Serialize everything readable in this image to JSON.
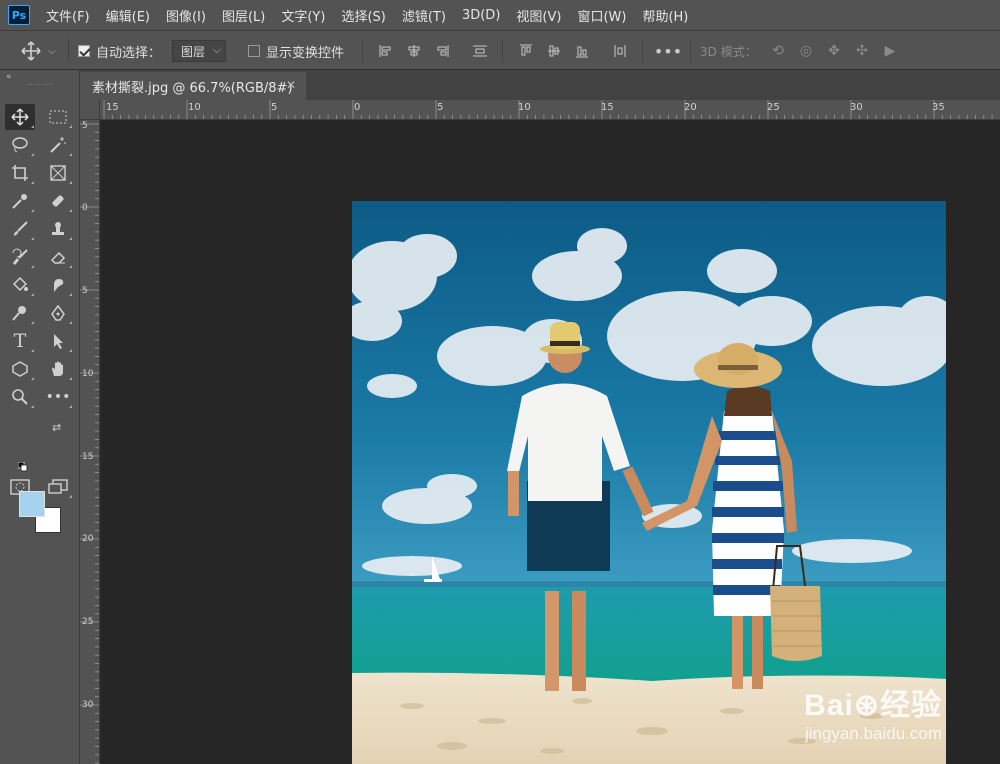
{
  "app": {
    "logo_text": "Ps"
  },
  "menu": {
    "items": [
      "文件(F)",
      "编辑(E)",
      "图像(I)",
      "图层(L)",
      "文字(Y)",
      "选择(S)",
      "滤镜(T)",
      "3D(D)",
      "视图(V)",
      "窗口(W)",
      "帮助(H)"
    ]
  },
  "options": {
    "auto_select_label": "自动选择：",
    "auto_select_value": "图层",
    "show_transform_label": "显示变换控件",
    "mode3d_label": "3D 模式："
  },
  "document": {
    "tab_title": "素材撕裂.jpg @ 66.7%(RGB/8#)",
    "close_glyph": "✕"
  },
  "ruler": {
    "top_labels": [
      "15",
      "10",
      "5",
      "0",
      "5",
      "10",
      "15",
      "20",
      "25",
      "30",
      "35"
    ],
    "left_labels": [
      "5",
      "0",
      "5",
      "10",
      "15",
      "20",
      "25",
      "30"
    ]
  },
  "colors": {
    "foreground": "#a7d2ee",
    "background": "#ffffff",
    "ui_panel": "#535353",
    "canvas_bg": "#262626"
  },
  "watermark": {
    "logo": "Bai⊛经验",
    "url": "jingyan.baidu.com"
  },
  "icons": {
    "toolbar": [
      "move-icon",
      "marquee-icon",
      "lasso-icon",
      "magic-wand-icon",
      "crop-icon",
      "frame-icon",
      "eyedropper-icon",
      "healing-icon",
      "brush-icon",
      "stamp-icon",
      "history-brush-icon",
      "eraser-icon",
      "paint-bucket-icon",
      "smudge-icon",
      "dodge-icon",
      "pen-icon",
      "type-icon",
      "path-select-icon",
      "shape-icon",
      "hand-icon",
      "zoom-icon",
      "more-icon"
    ]
  }
}
